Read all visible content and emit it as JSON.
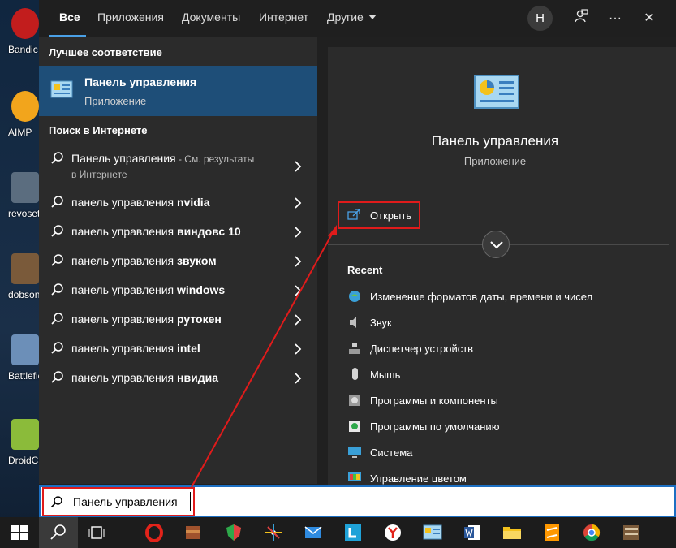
{
  "desktop": {
    "icons": [
      {
        "label": "Bandic",
        "color": "#c21d1d"
      },
      {
        "label": "AIMP",
        "color": "#f2a51c"
      },
      {
        "label": "revosetu",
        "color": "#5b6d7f"
      },
      {
        "label": "dobson",
        "color": "#7a5a3a"
      },
      {
        "label": "Battlefie",
        "color": "#6c8fb8"
      },
      {
        "label": "DroidCa",
        "color": "#8bbb3a"
      }
    ]
  },
  "tabs": [
    {
      "label": "Все",
      "active": true
    },
    {
      "label": "Приложения"
    },
    {
      "label": "Документы"
    },
    {
      "label": "Интернет"
    },
    {
      "label": "Другие"
    }
  ],
  "topbar": {
    "avatar_letter": "H",
    "feedback_icon": "feedback-icon",
    "more_label": "···",
    "close_label": "✕"
  },
  "best_match": {
    "heading": "Лучшее соответствие",
    "title": "Панель управления",
    "subtitle": "Приложение"
  },
  "web": {
    "heading": "Поиск в Интернете",
    "first": {
      "prefix": "Панель управления",
      "extra": " - См. результаты",
      "line2": "в Интернете"
    },
    "items": [
      {
        "prefix": "панель управления ",
        "bold": "nvidia"
      },
      {
        "prefix": "панель управления ",
        "bold": "виндовс 10"
      },
      {
        "prefix": "панель управления ",
        "bold": "звуком"
      },
      {
        "prefix": "панель управления ",
        "bold": "windows"
      },
      {
        "prefix": "панель управления ",
        "bold": "рутокен"
      },
      {
        "prefix": "панель управления ",
        "bold": "intel"
      },
      {
        "prefix": "панель управления ",
        "bold": "нвидиа"
      }
    ]
  },
  "detail": {
    "title": "Панель управления",
    "subtitle": "Приложение",
    "open_label": "Открыть",
    "recent_heading": "Recent",
    "recent": [
      {
        "label": "Изменение форматов даты, времени и чисел",
        "icon": "region-icon"
      },
      {
        "label": "Звук",
        "icon": "speaker-icon"
      },
      {
        "label": "Диспетчер устройств",
        "icon": "device-manager-icon"
      },
      {
        "label": "Мышь",
        "icon": "mouse-icon"
      },
      {
        "label": "Программы и компоненты",
        "icon": "programs-icon"
      },
      {
        "label": "Программы по умолчанию",
        "icon": "default-programs-icon"
      },
      {
        "label": "Система",
        "icon": "system-icon"
      },
      {
        "label": "Управление цветом",
        "icon": "color-management-icon"
      }
    ]
  },
  "search": {
    "value": "Панель управления"
  },
  "taskbar": {
    "items": [
      "start-icon",
      "search-icon",
      "task-view-icon",
      "opera-icon",
      "archive-icon",
      "shield-icon",
      "paint-icon",
      "mail-icon",
      "l-app-icon",
      "yandex-icon",
      "control-panel-icon",
      "word-icon",
      "folder-icon",
      "sublime-icon",
      "chrome-icon",
      "dobson-icon"
    ]
  },
  "colors": {
    "accent": "#1e4e78",
    "highlight": "#e01b1b",
    "tab_underline": "#4aa0e6"
  }
}
